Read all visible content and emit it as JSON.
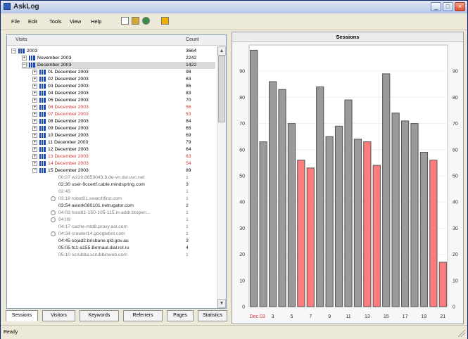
{
  "app": {
    "title": "AskLog"
  },
  "window_controls": {
    "minimize": "_",
    "maximize": "□",
    "close": "×"
  },
  "menu": {
    "items": [
      "File",
      "Edit",
      "Tools",
      "View",
      "Help"
    ]
  },
  "toolbar": {
    "icons": [
      "new-file-icon",
      "open-folder-icon",
      "globe-icon",
      "help-icon"
    ]
  },
  "tree": {
    "headers": {
      "name": "Visits",
      "count": "Count"
    },
    "rows": [
      {
        "label": "2003",
        "count": "3664"
      },
      {
        "label": "November 2003",
        "count": "2242"
      },
      {
        "label": "December 2003",
        "count": "1422"
      },
      {
        "label": "01 December 2003",
        "count": "98"
      },
      {
        "label": "02 December 2003",
        "count": "63"
      },
      {
        "label": "03 December 2003",
        "count": "86"
      },
      {
        "label": "04 December 2003",
        "count": "83"
      },
      {
        "label": "05 December 2003",
        "count": "70"
      },
      {
        "label": "06 December 2003",
        "count": "56"
      },
      {
        "label": "07 December 2003",
        "count": "53"
      },
      {
        "label": "08 December 2003",
        "count": "84"
      },
      {
        "label": "09 December 2003",
        "count": "65"
      },
      {
        "label": "10 December 2003",
        "count": "69"
      },
      {
        "label": "11 December 2003",
        "count": "79"
      },
      {
        "label": "12 December 2003",
        "count": "64"
      },
      {
        "label": "13 December 2003",
        "count": "63"
      },
      {
        "label": "14 December 2003",
        "count": "54"
      },
      {
        "label": "15 December 2003",
        "count": "89"
      },
      {
        "label": "00:27 w220.8653043.8.de-vn.dsl.ovc.net",
        "count": "1"
      },
      {
        "label": "02:30 user-9ccertf.cable.mindspring.com",
        "count": "3"
      },
      {
        "label": "02:45",
        "count": "1"
      },
      {
        "label": "03:18 robot01.searchfirst.com",
        "count": "1"
      },
      {
        "label": "03:54 awork080101.netrugator.com",
        "count": "2"
      },
      {
        "label": "04:03 host81-150-105-115.in-addr.btopen...",
        "count": "1"
      },
      {
        "label": "04:09",
        "count": "1"
      },
      {
        "label": "04:17 cache-mtd8.proxy.aol.com",
        "count": "1"
      },
      {
        "label": "04:34 crawler14.googlebot.com",
        "count": "1"
      },
      {
        "label": "04:45 sojad2.brisbane.qld.gov.au",
        "count": "3"
      },
      {
        "label": "05:05 tc1-a155.Bernaul.dial.rol.ru",
        "count": "4"
      },
      {
        "label": "05:10 scrubba.scrubbinweb.com",
        "count": "1"
      }
    ]
  },
  "tabs": [
    "Sessions",
    "Visitors",
    "Keywords",
    "Referrers",
    "Pages",
    "Statistics"
  ],
  "chart_title": "Sessions",
  "chart_data": {
    "type": "bar",
    "title": "Sessions",
    "xlabel": "",
    "ylabel": "",
    "ylim": [
      0,
      100
    ],
    "y_ticks": [
      0,
      10,
      20,
      30,
      40,
      50,
      60,
      70,
      80,
      90
    ],
    "x_tick_labels": [
      "Dec 03",
      "3",
      "5",
      "7",
      "9",
      "11",
      "13",
      "15",
      "17",
      "19",
      "21"
    ],
    "values": [
      98,
      63,
      86,
      83,
      70,
      56,
      53,
      84,
      65,
      69,
      79,
      64,
      63,
      54,
      89,
      74,
      71,
      70,
      59,
      56,
      17
    ],
    "colors": [
      "gray",
      "gray",
      "gray",
      "gray",
      "gray",
      "red",
      "red",
      "gray",
      "gray",
      "gray",
      "gray",
      "gray",
      "red",
      "red",
      "gray",
      "gray",
      "gray",
      "gray",
      "gray",
      "red",
      "red"
    ]
  },
  "status": {
    "text": "Ready"
  },
  "palette": {
    "gray_bar": "#9a9a9a",
    "red_bar": "#ff7c7c",
    "bar_outline": "#555555"
  }
}
